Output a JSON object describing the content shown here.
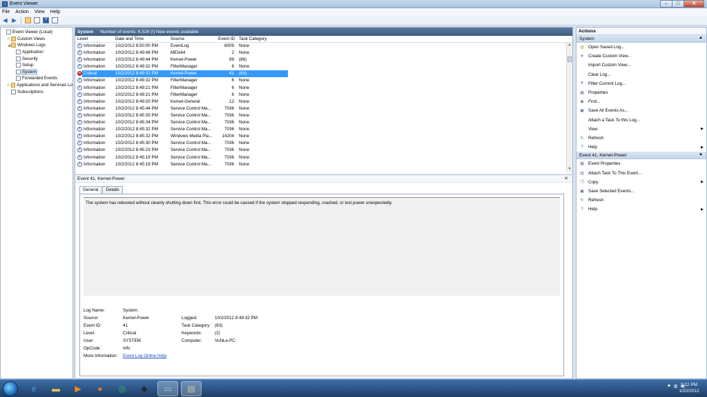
{
  "window": {
    "title": "Event Viewer"
  },
  "menu": [
    "File",
    "Action",
    "View",
    "Help"
  ],
  "tree": [
    {
      "label": "Event Viewer (Local)",
      "indent": 0,
      "exp": "",
      "icon": "log"
    },
    {
      "label": "Custom Views",
      "indent": 1,
      "exp": "▷",
      "icon": "folder"
    },
    {
      "label": "Windows Logs",
      "indent": 1,
      "exp": "◢",
      "icon": "folder"
    },
    {
      "label": "Application",
      "indent": 2,
      "exp": "",
      "icon": "log"
    },
    {
      "label": "Security",
      "indent": 2,
      "exp": "",
      "icon": "log"
    },
    {
      "label": "Setup",
      "indent": 2,
      "exp": "",
      "icon": "log"
    },
    {
      "label": "System",
      "indent": 2,
      "exp": "",
      "icon": "log",
      "selected": true
    },
    {
      "label": "Forwarded Events",
      "indent": 2,
      "exp": "",
      "icon": "log"
    },
    {
      "label": "Applications and Services Lo",
      "indent": 1,
      "exp": "▷",
      "icon": "folder"
    },
    {
      "label": "Subscriptions",
      "indent": 1,
      "exp": "",
      "icon": "log"
    }
  ],
  "list": {
    "name": "System",
    "count_text": "Number of events: 6,526 (!) New events available",
    "columns": [
      "Level",
      "Date and Time",
      "Source",
      "Event ID",
      "Task Category"
    ],
    "rows": [
      {
        "level": "Information",
        "date": "10/2/2012 8:50:00 PM",
        "source": "EventLog",
        "id": "6009",
        "task": "None"
      },
      {
        "level": "Information",
        "date": "10/2/2012 8:49:48 PM",
        "source": "MEIx64",
        "id": "2",
        "task": "None"
      },
      {
        "level": "Information",
        "date": "10/2/2012 8:49:44 PM",
        "source": "Kernel-Power",
        "id": "89",
        "task": "(86)"
      },
      {
        "level": "Information",
        "date": "10/2/2012 8:49:32 PM",
        "source": "FilterManager",
        "id": "6",
        "task": "None"
      },
      {
        "level": "Critical",
        "date": "10/2/2012 8:49:32 PM",
        "source": "Kernel-Power",
        "id": "41",
        "task": "(63)",
        "selected": true
      },
      {
        "level": "Information",
        "date": "10/2/2012 8:49:32 PM",
        "source": "FilterManager",
        "id": "6",
        "task": "None"
      },
      {
        "level": "Information",
        "date": "10/2/2012 8:49:21 PM",
        "source": "FilterManager",
        "id": "6",
        "task": "None"
      },
      {
        "level": "Information",
        "date": "10/2/2012 8:49:21 PM",
        "source": "FilterManager",
        "id": "6",
        "task": "None"
      },
      {
        "level": "Information",
        "date": "10/2/2012 8:49:20 PM",
        "source": "Kernel-General",
        "id": "12",
        "task": "None"
      },
      {
        "level": "Information",
        "date": "10/2/2012 8:45:44 PM",
        "source": "Service Control Ma...",
        "id": "7036",
        "task": "None"
      },
      {
        "level": "Information",
        "date": "10/2/2012 8:45:35 PM",
        "source": "Service Control Ma...",
        "id": "7036",
        "task": "None"
      },
      {
        "level": "Information",
        "date": "10/2/2012 8:45:34 PM",
        "source": "Service Control Ma...",
        "id": "7036",
        "task": "None"
      },
      {
        "level": "Information",
        "date": "10/2/2012 8:45:32 PM",
        "source": "Service Control Ma...",
        "id": "7036",
        "task": "None"
      },
      {
        "level": "Information",
        "date": "10/2/2012 8:45:32 PM",
        "source": "Windows Media Pla...",
        "id": "14204",
        "task": "None"
      },
      {
        "level": "Information",
        "date": "10/2/2012 8:45:30 PM",
        "source": "Service Control Ma...",
        "id": "7036",
        "task": "None"
      },
      {
        "level": "Information",
        "date": "10/2/2012 8:45:23 PM",
        "source": "Service Control Ma...",
        "id": "7036",
        "task": "None"
      },
      {
        "level": "Information",
        "date": "10/2/2012 8:45:19 PM",
        "source": "Service Control Ma...",
        "id": "7036",
        "task": "None"
      },
      {
        "level": "Information",
        "date": "10/2/2012 8:45:18 PM",
        "source": "Service Control Ma...",
        "id": "7036",
        "task": "None"
      }
    ]
  },
  "detail": {
    "title": "Event 41, Kernel-Power",
    "tabs": [
      "General",
      "Details"
    ],
    "description": "The system has rebooted without cleanly shutting down first. This error could be caused if the system stopped responding, crashed, or lost power unexpectedly.",
    "props": {
      "log_name_label": "Log Name:",
      "log_name": "System",
      "source_label": "Source:",
      "source": "Kernel-Power",
      "logged_label": "Logged:",
      "logged": "10/2/2012 8:49:32 PM",
      "event_id_label": "Event ID:",
      "event_id": "41",
      "task_label": "Task Category:",
      "task": "(63)",
      "level_label": "Level:",
      "level": "Critical",
      "keywords_label": "Keywords:",
      "keywords": "(2)",
      "user_label": "User:",
      "user": "SYSTEM",
      "computer_label": "Computer:",
      "computer": "VuNLe-PC",
      "opcode_label": "OpCode:",
      "opcode": "Info",
      "more_label": "More Information:",
      "more_link": "Event Log Online Help"
    }
  },
  "actions": {
    "header": "Actions",
    "section1": "System",
    "section1_items": [
      {
        "label": "Open Saved Log...",
        "icon": "open-folder-icon",
        "glyph": "▤",
        "color": "#c79a2e",
        "sub": false
      },
      {
        "label": "Create Custom View...",
        "icon": "filter-icon",
        "glyph": "▼",
        "color": "#5a7fb3",
        "sub": false
      },
      {
        "label": "Import Custom View...",
        "icon": "",
        "glyph": "",
        "color": "#000",
        "sub": false
      },
      {
        "label": "Clear Log...",
        "icon": "",
        "glyph": "",
        "color": "#000",
        "sub": false
      },
      {
        "label": "Filter Current Log...",
        "icon": "filter-icon",
        "glyph": "▼",
        "color": "#5a7fb3",
        "sub": false
      },
      {
        "label": "Properties",
        "icon": "properties-icon",
        "glyph": "▦",
        "color": "#6b7c93",
        "sub": false
      },
      {
        "label": "Find...",
        "icon": "find-icon",
        "glyph": "◉",
        "color": "#5a6f8c",
        "sub": false
      },
      {
        "label": "Save All Events As...",
        "icon": "save-icon",
        "glyph": "▣",
        "color": "#5a6f8c",
        "sub": false
      },
      {
        "label": "Attach a Task To this Log...",
        "icon": "",
        "glyph": "",
        "color": "#000",
        "sub": false
      },
      {
        "label": "View",
        "icon": "",
        "glyph": "",
        "color": "#000",
        "sub": true
      },
      {
        "label": "Refresh",
        "icon": "refresh-icon",
        "glyph": "↻",
        "color": "#2e9a3a",
        "sub": false
      },
      {
        "label": "Help",
        "icon": "help-icon",
        "glyph": "?",
        "color": "#2c5fa8",
        "sub": true
      }
    ],
    "section2": "Event 41, Kernel-Power",
    "section2_items": [
      {
        "label": "Event Properties",
        "icon": "event-properties-icon",
        "glyph": "▦",
        "color": "#6b7c93",
        "sub": false
      },
      {
        "label": "Attach Task To This Event...",
        "icon": "attach-task-icon",
        "glyph": "▥",
        "color": "#6b7c93",
        "sub": false
      },
      {
        "label": "Copy",
        "icon": "copy-icon",
        "glyph": "❐",
        "color": "#6b7c93",
        "sub": true
      },
      {
        "label": "Save Selected Events...",
        "icon": "save-icon",
        "glyph": "▣",
        "color": "#5a6f8c",
        "sub": false
      },
      {
        "label": "Refresh",
        "icon": "refresh-icon",
        "glyph": "↻",
        "color": "#2e9a3a",
        "sub": false
      },
      {
        "label": "Help",
        "icon": "help-icon",
        "glyph": "?",
        "color": "#2c5fa8",
        "sub": true
      }
    ]
  },
  "taskbar": {
    "apps": [
      {
        "name": "ie-icon",
        "glyph": "e",
        "color": "#3aa0e8"
      },
      {
        "name": "explorer-icon",
        "glyph": "▬",
        "color": "#e8c25a"
      },
      {
        "name": "media-player-icon",
        "glyph": "▶",
        "color": "#f08a1d"
      },
      {
        "name": "firefox-icon",
        "glyph": "●",
        "color": "#e8721d"
      },
      {
        "name": "chrome-icon",
        "glyph": "◎",
        "color": "#3cba54"
      },
      {
        "name": "app-icon",
        "glyph": "◆",
        "color": "#2a2a2a"
      },
      {
        "name": "computer-icon",
        "glyph": "▭",
        "color": "#9ad0f5"
      },
      {
        "name": "event-viewer-icon",
        "glyph": "▤",
        "color": "#d0c8a0"
      }
    ],
    "time": "9:12 PM",
    "date": "10/2/2012"
  }
}
